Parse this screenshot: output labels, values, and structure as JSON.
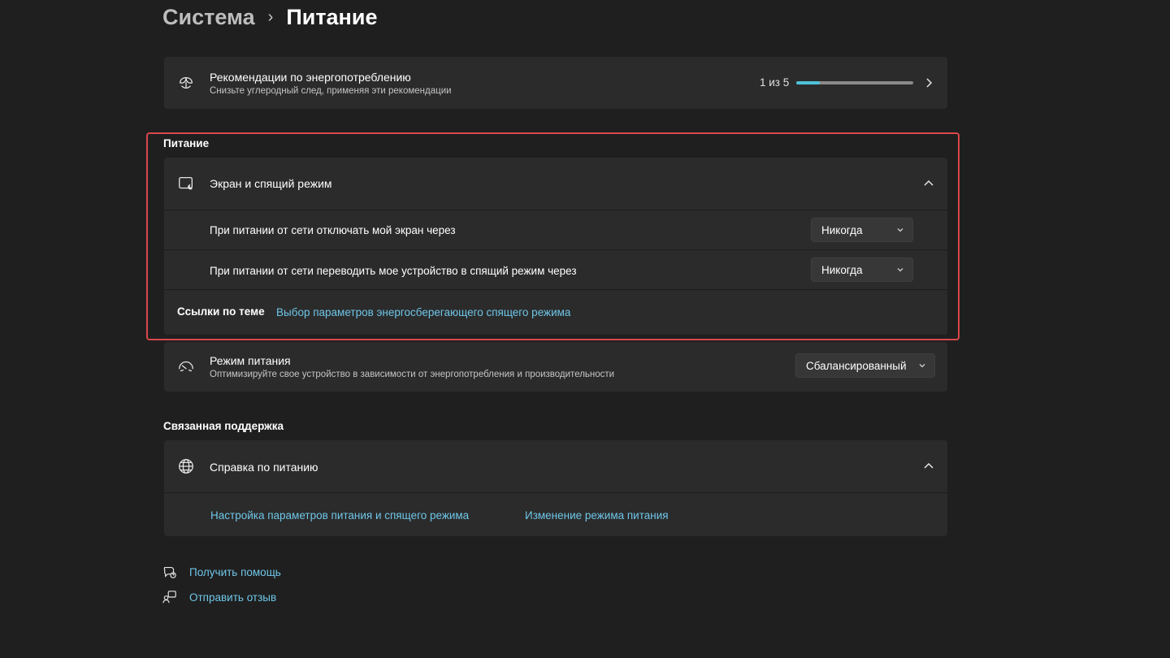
{
  "breadcrumb": {
    "parent": "Система",
    "separator": "›",
    "current": "Питание"
  },
  "energy_recommendations": {
    "title": "Рекомендации по энергопотреблению",
    "subtitle": "Снизьте углеродный след, применяя эти рекомендации",
    "progress_text": "1 из 5",
    "progress_fraction": 0.2,
    "icon": "leaf-icon"
  },
  "power_section": {
    "label": "Питание",
    "screen_sleep": {
      "title": "Экран и спящий режим",
      "icon": "screen-sleep-icon",
      "expanded": true,
      "settings": [
        {
          "label": "При питании от сети отключать мой экран через",
          "value": "Никогда"
        },
        {
          "label": "При питании от сети переводить мое устройство в спящий режим через",
          "value": "Никогда"
        }
      ],
      "related_label": "Ссылки по теме",
      "related_link": "Выбор параметров энергосберегающего спящего режима"
    },
    "power_mode": {
      "title": "Режим питания",
      "subtitle": "Оптимизируйте свое устройство в зависимости от энергопотребления и производительности",
      "value": "Сбалансированный",
      "icon": "gauge-icon"
    }
  },
  "support_section": {
    "label": "Связанная поддержка",
    "help": {
      "title": "Справка по питанию",
      "icon": "globe-icon",
      "links": [
        "Настройка параметров питания и спящего режима",
        "Изменение режима питания"
      ]
    }
  },
  "footer": {
    "get_help": "Получить помощь",
    "send_feedback": "Отправить отзыв"
  },
  "colors": {
    "background": "#1f1f1f",
    "card": "#2b2b2b",
    "accent_progress": "#4cc2d9",
    "link": "#6fc6e8",
    "highlight_border": "#d9474b"
  }
}
